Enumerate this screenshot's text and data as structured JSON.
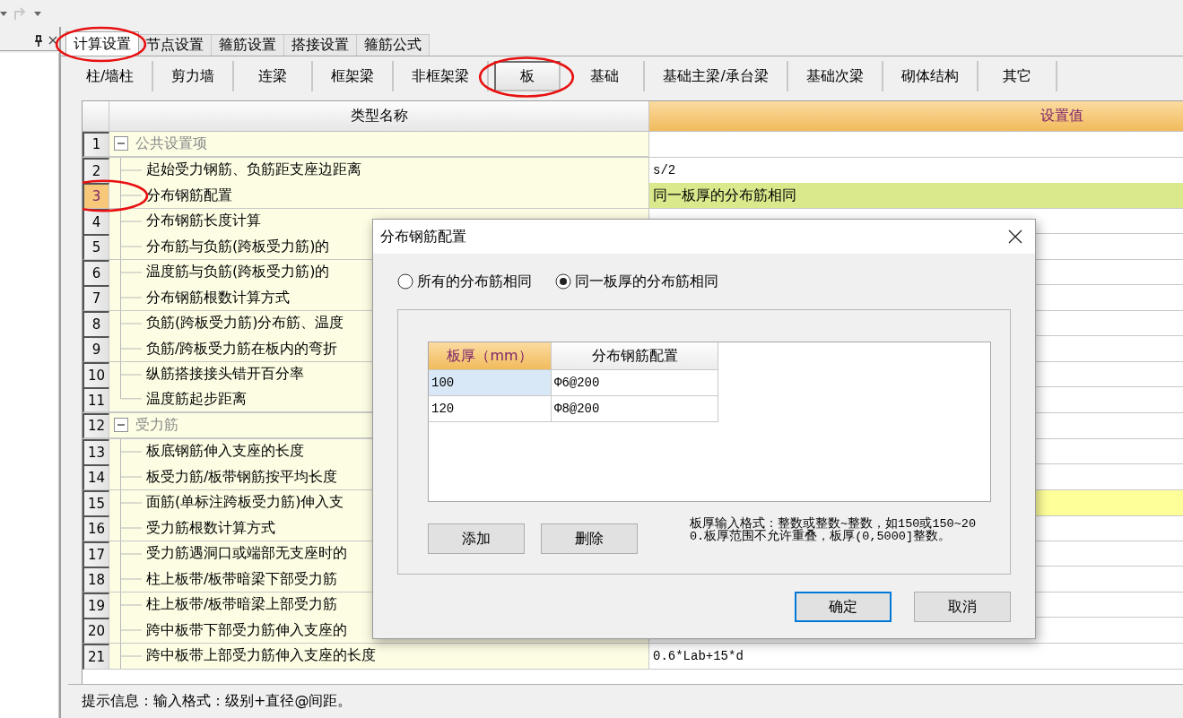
{
  "tabs": [
    {
      "label": "计算设置",
      "selected": true,
      "circled": true
    },
    {
      "label": "节点设置",
      "selected": false,
      "circled": false
    },
    {
      "label": "箍筋设置",
      "selected": false,
      "circled": false
    },
    {
      "label": "搭接设置",
      "selected": false,
      "circled": false
    },
    {
      "label": "箍筋公式",
      "selected": false,
      "circled": false
    }
  ],
  "subtabs": [
    {
      "label": "柱/墙柱",
      "selected": false,
      "circled": false
    },
    {
      "label": "剪力墙",
      "selected": false,
      "circled": false
    },
    {
      "label": "连梁",
      "selected": false,
      "circled": false
    },
    {
      "label": "框架梁",
      "selected": false,
      "circled": false
    },
    {
      "label": "非框架梁",
      "selected": false,
      "circled": false
    },
    {
      "label": "板",
      "selected": true,
      "circled": true
    },
    {
      "label": "基础",
      "selected": false,
      "circled": false
    },
    {
      "label": "基础主梁/承台梁",
      "selected": false,
      "circled": false
    },
    {
      "label": "基础次梁",
      "selected": false,
      "circled": false
    },
    {
      "label": "砌体结构",
      "selected": false,
      "circled": false
    },
    {
      "label": "其它",
      "selected": false,
      "circled": false
    }
  ],
  "grid": {
    "columns": [
      {
        "label": "类型名称",
        "selected": false
      },
      {
        "label": "设置值",
        "selected": true
      }
    ],
    "rows": [
      {
        "number": "1",
        "kind": "group",
        "name": "公共设置项",
        "selected": false,
        "circled": false
      },
      {
        "number": "2",
        "kind": "item",
        "name": "起始受力钢筋、负筋距支座边距离",
        "value": "s/2",
        "selected": false,
        "circled": false
      },
      {
        "number": "3",
        "kind": "item",
        "name": "分布钢筋配置",
        "value": "同一板厚的分布筋相同",
        "selected": true,
        "circled": true
      },
      {
        "number": "4",
        "kind": "item",
        "name": "分布钢筋长度计算",
        "selected": false,
        "circled": false
      },
      {
        "number": "5",
        "kind": "item",
        "name": "分布筋与负筋(跨板受力筋)的",
        "selected": false,
        "circled": false
      },
      {
        "number": "6",
        "kind": "item",
        "name": "温度筋与负筋(跨板受力筋)的",
        "selected": false,
        "circled": false
      },
      {
        "number": "7",
        "kind": "item",
        "name": "分布钢筋根数计算方式",
        "selected": false,
        "circled": false
      },
      {
        "number": "8",
        "kind": "item",
        "name": "负筋(跨板受力筋)分布筋、温度",
        "selected": false,
        "circled": false
      },
      {
        "number": "9",
        "kind": "item",
        "name": "负筋/跨板受力筋在板内的弯折",
        "selected": false,
        "circled": false
      },
      {
        "number": "10",
        "kind": "item",
        "name": "纵筋搭接接头错开百分率",
        "selected": false,
        "circled": false
      },
      {
        "number": "11",
        "kind": "last_item",
        "name": "温度筋起步距离",
        "selected": false,
        "circled": false
      },
      {
        "number": "12",
        "kind": "group",
        "name": "受力筋",
        "selected": false,
        "circled": false
      },
      {
        "number": "13",
        "kind": "item",
        "name": "板底钢筋伸入支座的长度",
        "selected": false,
        "circled": false
      },
      {
        "number": "14",
        "kind": "item",
        "name": "板受力筋/板带钢筋按平均长度",
        "selected": false,
        "circled": false
      },
      {
        "number": "15",
        "kind": "item",
        "name": "面筋(单标注跨板受力筋)伸入支",
        "modified": true,
        "selected": false,
        "circled": false
      },
      {
        "number": "16",
        "kind": "item",
        "name": "受力筋根数计算方式",
        "selected": false,
        "circled": false
      },
      {
        "number": "17",
        "kind": "item",
        "name": "受力筋遇洞口或端部无支座时的",
        "selected": false,
        "circled": false
      },
      {
        "number": "18",
        "kind": "item",
        "name": "柱上板带/板带暗梁下部受力筋",
        "selected": false,
        "circled": false
      },
      {
        "number": "19",
        "kind": "item",
        "name": "柱上板带/板带暗梁上部受力筋",
        "selected": false,
        "circled": false
      },
      {
        "number": "20",
        "kind": "item",
        "name": "跨中板带下部受力筋伸入支座的",
        "selected": false,
        "circled": false
      },
      {
        "number": "21",
        "kind": "item",
        "name": "跨中板带上部受力筋伸入支座的长度",
        "value": "0.6*Lab+15*d",
        "selected": false,
        "circled": false
      }
    ]
  },
  "status_bar": "提示信息：输入格式：级别+直径@间距。",
  "dialog": {
    "title": "分布钢筋配置",
    "options": [
      {
        "label": "所有的分布筋相同",
        "selected": false
      },
      {
        "label": "同一板厚的分布筋相同",
        "selected": true
      }
    ],
    "table": {
      "columns": [
        {
          "label": "板厚（mm）",
          "selected": true
        },
        {
          "label": "分布钢筋配置",
          "selected": false
        }
      ],
      "rows": [
        {
          "cells": [
            "100",
            "Φ6@200"
          ],
          "selected": true
        },
        {
          "cells": [
            "120",
            "Φ8@200"
          ],
          "selected": false
        }
      ]
    },
    "buttons": [
      {
        "label": "添加"
      },
      {
        "label": "删除"
      }
    ],
    "hint": "板厚输入格式：整数或整数~整数，如150或150~200.板厚范围不允许重叠，板厚(0,5000]整数。",
    "actions": [
      {
        "label": "确定",
        "focused": true
      },
      {
        "label": "取消",
        "focused": false
      }
    ]
  }
}
